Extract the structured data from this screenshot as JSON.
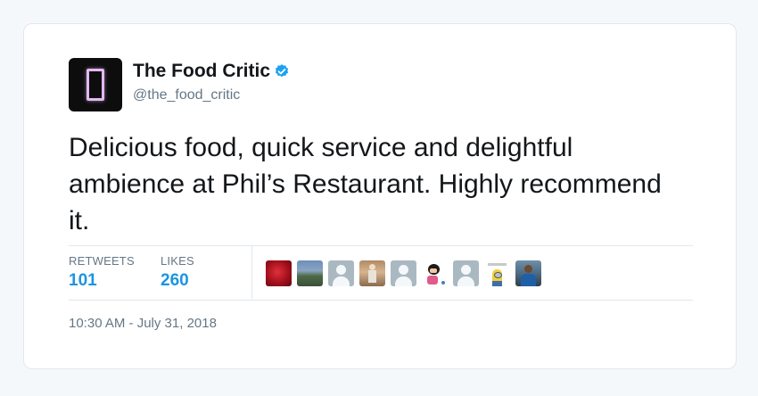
{
  "tweet": {
    "display_name": "The Food Critic",
    "handle": "@the_food_critic",
    "verified": true,
    "text": "Delicious food, quick service and delightful ambience at Phil’s Restaurant. Highly recommend it.",
    "timestamp": "10:30 AM - July 31, 2018"
  },
  "stats": {
    "retweets_label": "RETWEETS",
    "retweets_value": "101",
    "likes_label": "LIKES",
    "likes_value": "260"
  },
  "likers": [
    {
      "icon": "rose-photo-avatar"
    },
    {
      "icon": "landscape-photo-avatar"
    },
    {
      "icon": "default-profile-avatar"
    },
    {
      "icon": "person-photo-avatar"
    },
    {
      "icon": "default-profile-avatar"
    },
    {
      "icon": "cartoon-avatar"
    },
    {
      "icon": "default-profile-avatar"
    },
    {
      "icon": "minion-avatar"
    },
    {
      "icon": "person-photo-avatar"
    }
  ],
  "colors": {
    "link_blue": "#1b95e0",
    "verified_blue": "#1da1f2",
    "muted": "#657786",
    "text": "#14171a"
  }
}
